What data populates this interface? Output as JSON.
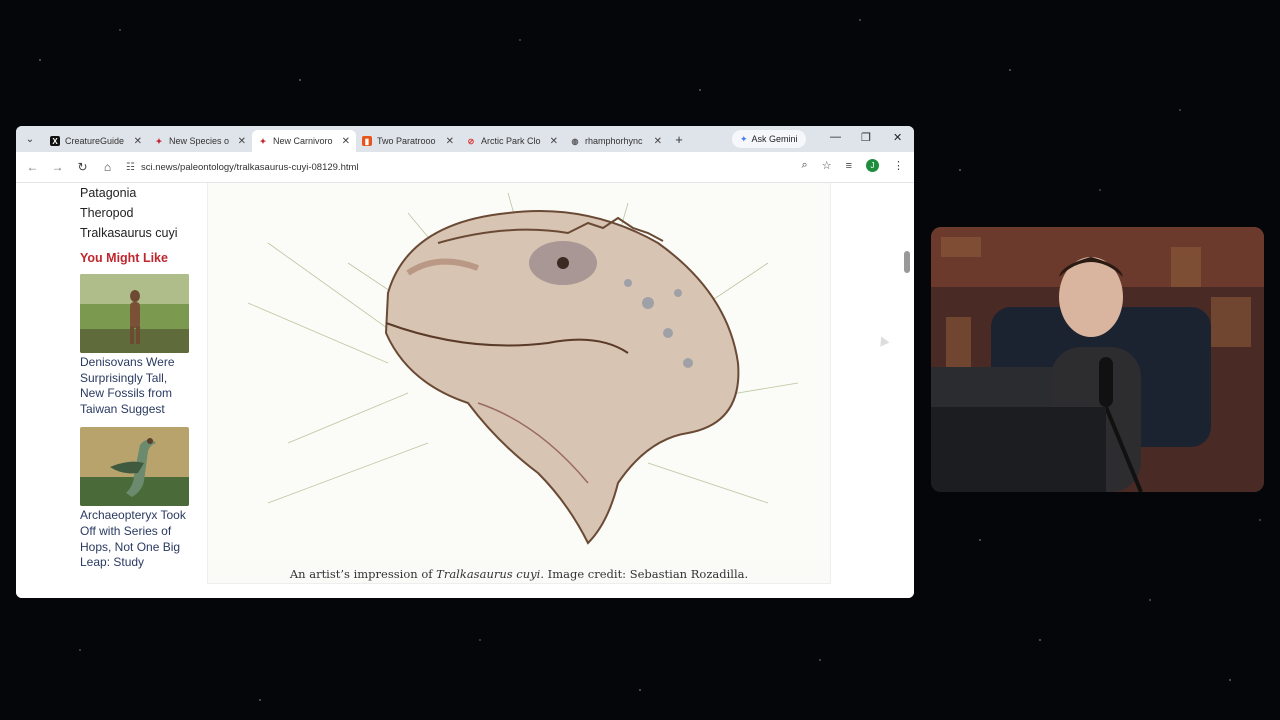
{
  "browser": {
    "tabs": [
      {
        "title": "CreatureGuide",
        "icon": "x-logo-icon",
        "active": false
      },
      {
        "title": "New Species o",
        "icon": "sci-news-icon",
        "active": false
      },
      {
        "title": "New Carnivoro",
        "icon": "sci-news-icon",
        "active": true
      },
      {
        "title": "Two Paratrooo",
        "icon": "bookmark-icon",
        "active": false
      },
      {
        "title": "Arctic Park Clo",
        "icon": "link-icon",
        "active": false
      },
      {
        "title": "rhamphorhync",
        "icon": "globe-icon",
        "active": false
      }
    ],
    "ask_gemini_label": "Ask Gemini",
    "url": "sci.news/paleontology/tralkasaurus-cuyi-08129.html",
    "profile_initial": "J"
  },
  "sidebar": {
    "tags": [
      "Patagonia",
      "Theropod",
      "Tralkasaurus cuyi"
    ],
    "you_might_like": "You Might Like",
    "cards": [
      {
        "title": "Denisovans Were Surprisingly Tall, New Fossils from Taiwan Suggest"
      },
      {
        "title": "Archaeopteryx Took Off with Series of Hops, Not One Big Leap: Study"
      }
    ]
  },
  "figure": {
    "caption_before": "An artist’s impression of ",
    "caption_italic": "Tralkasaurus cuyi",
    "caption_after": ". Image credit: Sebastian Rozadilla."
  },
  "colors": {
    "accent_red": "#c0262d",
    "link_blue": "#2a3a60",
    "profile_green": "#1e8e3e"
  }
}
